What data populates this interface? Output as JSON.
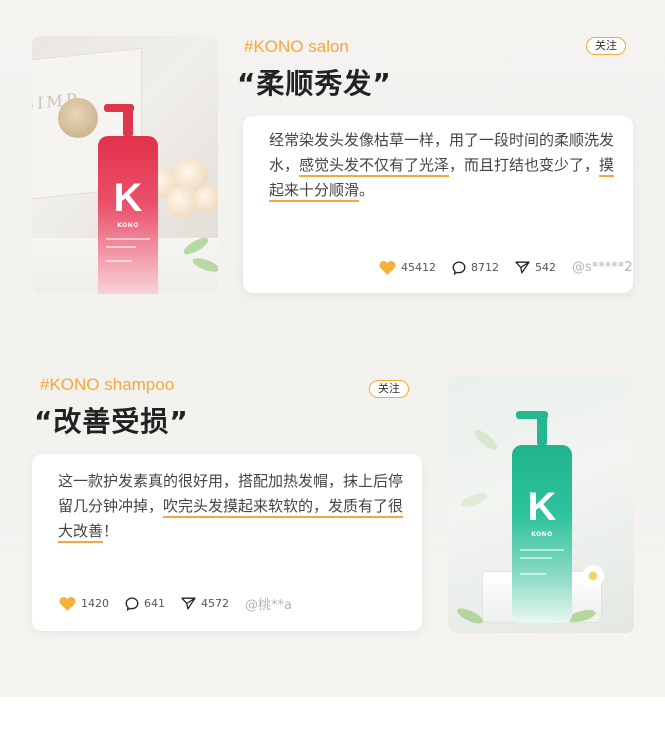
{
  "section1": {
    "tag": "#KONO salon",
    "headline": "“柔顺秀发”",
    "follow_label": "关注",
    "photo": {
      "frame_text": "SIMP",
      "brand_letter": "K",
      "brand_name": "KONO"
    },
    "review": {
      "part1": "经常染发头发像枯草一样，用了一段时间的柔顺洗发水，",
      "highlight1": "感觉头发不仅有了光泽",
      "part2": "，而且打结也变少了，",
      "highlight2": "摸起来十分顺滑",
      "part3": "。"
    },
    "stats": {
      "likes": "45412",
      "comments": "8712",
      "shares": "542",
      "user": "@s*****2"
    }
  },
  "section2": {
    "tag": "#KONO shampoo",
    "headline": "“改善受损”",
    "follow_label": "关注",
    "photo": {
      "brand_letter": "K",
      "brand_name": "KONO"
    },
    "review": {
      "part1": "这一款护发素真的很好用，搭配加热发帽，抹上后停留几分钟冲掉，",
      "highlight1": "吹完头发摸起来软软的，发质有了很大改善",
      "part2": "！"
    },
    "stats": {
      "likes": "1420",
      "comments": "641",
      "shares": "4572",
      "user": "@桃**a"
    }
  },
  "colors": {
    "accent": "#f2a93b",
    "heart": "#f5b335",
    "red_bottle": "#e3314b",
    "green_bottle": "#1fb38e"
  },
  "icons": {
    "like": "heart-icon",
    "comment": "comment-bubble-icon",
    "share": "send-icon"
  }
}
